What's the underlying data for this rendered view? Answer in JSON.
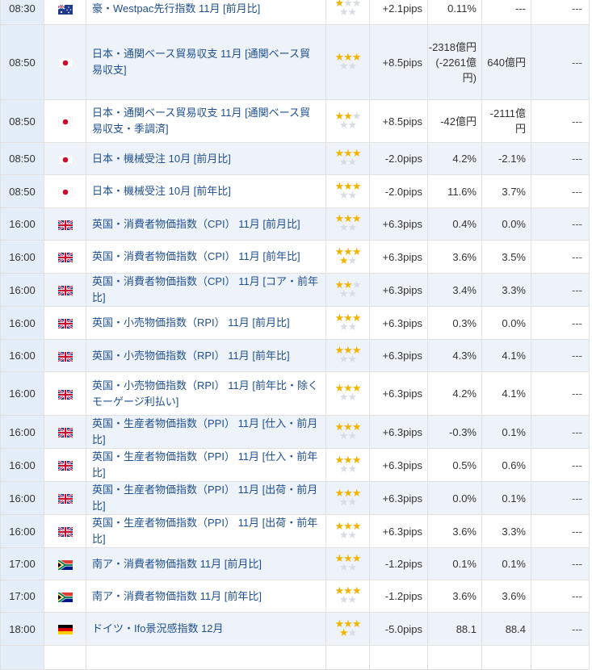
{
  "rows": [
    {
      "time": "08:30",
      "flag": "au",
      "name": "豪・Westpac先行指数 11月 [前月比]",
      "stars": 1,
      "pips": "+2.1pips",
      "previous": "0.11%",
      "forecast": "---",
      "result": "---",
      "h": 40
    },
    {
      "time": "08:50",
      "flag": "jp",
      "name": "日本・通関ベース貿易収支 11月 [通関ベース貿易収支]",
      "stars": 3,
      "pips": "+8.5pips",
      "previous": "-2318億円 (-2261億円)",
      "forecast": "640億円",
      "result": "---",
      "h": 93
    },
    {
      "time": "08:50",
      "flag": "jp",
      "name": "日本・通関ベース貿易収支 11月 [通関ベース貿易収支・季調済]",
      "stars": 2,
      "pips": "+8.5pips",
      "previous": "-42億円",
      "forecast": "-2111億円",
      "result": "---",
      "h": 53
    },
    {
      "time": "08:50",
      "flag": "jp",
      "name": "日本・機械受注 10月 [前月比]",
      "stars": 3,
      "pips": "-2.0pips",
      "previous": "4.2%",
      "forecast": "-2.1%",
      "result": "---",
      "h": 40
    },
    {
      "time": "08:50",
      "flag": "jp",
      "name": "日本・機械受注 10月 [前年比]",
      "stars": 3,
      "pips": "-2.0pips",
      "previous": "11.6%",
      "forecast": "3.7%",
      "result": "---",
      "h": 41
    },
    {
      "time": "16:00",
      "flag": "gb",
      "name": "英国・消費者物価指数（CPI） 11月 [前月比]",
      "stars": 3,
      "pips": "+6.3pips",
      "previous": "0.4%",
      "forecast": "0.0%",
      "result": "---",
      "h": 40
    },
    {
      "time": "16:00",
      "flag": "gb",
      "name": "英国・消費者物価指数（CPI） 11月 [前年比]",
      "stars": 4,
      "pips": "+6.3pips",
      "previous": "3.6%",
      "forecast": "3.5%",
      "result": "---",
      "h": 41
    },
    {
      "time": "16:00",
      "flag": "gb",
      "name": "英国・消費者物価指数（CPI） 11月 [コア・前年比]",
      "stars": 2,
      "pips": "+6.3pips",
      "previous": "3.4%",
      "forecast": "3.3%",
      "result": "---",
      "h": 40
    },
    {
      "time": "16:00",
      "flag": "gb",
      "name": "英国・小売物価指数（RPI） 11月 [前月比]",
      "stars": 3,
      "pips": "+6.3pips",
      "previous": "0.3%",
      "forecast": "0.0%",
      "result": "---",
      "h": 41
    },
    {
      "time": "16:00",
      "flag": "gb",
      "name": "英国・小売物価指数（RPI） 11月 [前年比]",
      "stars": 3,
      "pips": "+6.3pips",
      "previous": "4.3%",
      "forecast": "4.1%",
      "result": "---",
      "h": 40
    },
    {
      "time": "16:00",
      "flag": "gb",
      "name": "英国・小売物価指数（RPI） 11月 [前年比・除くモーゲージ利払い]",
      "stars": 3,
      "pips": "+6.3pips",
      "previous": "4.2%",
      "forecast": "4.1%",
      "result": "---",
      "h": 54
    },
    {
      "time": "16:00",
      "flag": "gb",
      "name": "英国・生産者物価指数（PPI） 11月 [仕入・前月比]",
      "stars": 3,
      "pips": "+6.3pips",
      "previous": "-0.3%",
      "forecast": "0.1%",
      "result": "---",
      "h": 40
    },
    {
      "time": "16:00",
      "flag": "gb",
      "name": "英国・生産者物価指数（PPI） 11月 [仕入・前年比]",
      "stars": 3,
      "pips": "+6.3pips",
      "previous": "0.5%",
      "forecast": "0.6%",
      "result": "---",
      "h": 41
    },
    {
      "time": "16:00",
      "flag": "gb",
      "name": "英国・生産者物価指数（PPI） 11月 [出荷・前月比]",
      "stars": 3,
      "pips": "+6.3pips",
      "previous": "0.0%",
      "forecast": "0.1%",
      "result": "---",
      "h": 40
    },
    {
      "time": "16:00",
      "flag": "gb",
      "name": "英国・生産者物価指数（PPI） 11月 [出荷・前年比]",
      "stars": 3,
      "pips": "+6.3pips",
      "previous": "3.6%",
      "forecast": "3.3%",
      "result": "---",
      "h": 41
    },
    {
      "time": "17:00",
      "flag": "za",
      "name": "南ア・消費者物価指数 11月 [前月比]",
      "stars": 3,
      "pips": "-1.2pips",
      "previous": "0.1%",
      "forecast": "0.1%",
      "result": "---",
      "h": 40
    },
    {
      "time": "17:00",
      "flag": "za",
      "name": "南ア・消費者物価指数 11月 [前年比]",
      "stars": 3,
      "pips": "-1.2pips",
      "previous": "3.6%",
      "forecast": "3.6%",
      "result": "---",
      "h": 40
    },
    {
      "time": "18:00",
      "flag": "de",
      "name": "ドイツ・Ifo景況感指数 12月",
      "stars": 4,
      "pips": "-5.0pips",
      "previous": "88.1",
      "forecast": "88.4",
      "result": "---",
      "h": 41
    },
    {
      "time": "",
      "flag": "",
      "name": "",
      "stars": 0,
      "pips": "",
      "previous": "",
      "forecast": "",
      "result": "",
      "h": 30
    }
  ]
}
